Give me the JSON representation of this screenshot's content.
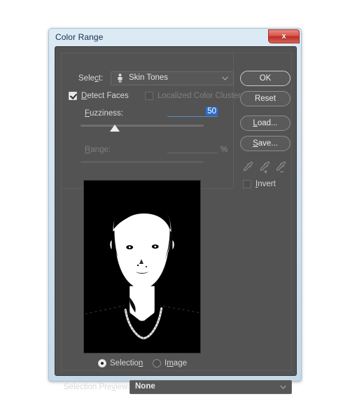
{
  "window": {
    "title": "Color Range",
    "close_label": "x",
    "close_icon": "close-icon"
  },
  "select_row": {
    "label": "Select:",
    "value": "Skin Tones",
    "icon": "person-icon",
    "arrow_icon": "chevron-down-icon"
  },
  "options": {
    "detect_faces": {
      "label": "Detect Faces",
      "checked": true,
      "enabled": true
    },
    "localized_color_clusters": {
      "label": "Localized Color Clusters",
      "checked": false,
      "enabled": false
    }
  },
  "fuzziness": {
    "label": "Fuzziness:",
    "value": "50",
    "slider_percent": 28,
    "enabled": true
  },
  "range": {
    "label": "Range:",
    "value": "",
    "unit": "%",
    "slider_percent": 0,
    "enabled": false
  },
  "preview": {
    "name": "selection-mask-preview",
    "description": "Black and white selection mask of a face with a chain necklace",
    "mode_options": [
      {
        "label": "Selection",
        "selected": true
      },
      {
        "label": "Image",
        "selected": false
      }
    ]
  },
  "selection_preview": {
    "label": "Selection Preview:",
    "value": "None",
    "arrow_icon": "chevron-down-icon"
  },
  "buttons": {
    "ok": "OK",
    "reset": "Reset",
    "load": "Load...",
    "save": "Save..."
  },
  "eyedroppers": [
    {
      "name": "eyedropper-icon",
      "mode": "sample"
    },
    {
      "name": "eyedropper-add-icon",
      "mode": "add"
    },
    {
      "name": "eyedropper-subtract-icon",
      "mode": "subtract"
    }
  ],
  "invert": {
    "label": "Invert",
    "checked": false
  },
  "colors": {
    "panel_bg": "#535353",
    "frame_bg": "#cfe0ee",
    "titlebar_text": "#17304a",
    "close_button": "#d9544a",
    "highlight": "#2a6fd0",
    "text": "#d8d8d8",
    "text_disabled": "#7f7f7f"
  }
}
